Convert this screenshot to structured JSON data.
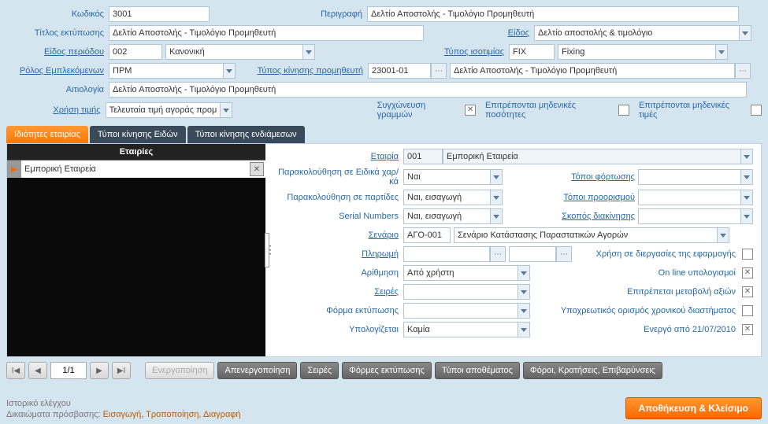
{
  "header": {
    "code_label": "Κωδικός",
    "code": "3001",
    "desc_label": "Περιγραφή",
    "desc": "Δελτίο Αποστολής - Τιμολόγιο Προμηθευτή",
    "print_title_label": "Τίτλος εκτύπωσης",
    "print_title": "Δελτίο Αποστολής - Τιμολόγιο Προμηθευτή",
    "type_label": "Είδος",
    "type": "Δελτίο αποστολής & τιμολόγιο",
    "period_type_label": "Είδος περιόδου",
    "period_code": "002",
    "period_name": "Κανονική",
    "rate_type_label": "Τύπος ισοτιμίας",
    "rate_code": "FIX",
    "rate_name": "Fixing",
    "role_label": "Ρόλος Εμπλεκόμενων",
    "role": "ΠΡΜ",
    "supplier_move_label": "Τύπος κίνησης προμηθευτή",
    "supplier_move_code": "23001-01",
    "supplier_move_name": "Δελτίο Αποστολής - Τιμολόγιο Προμηθευτή",
    "reason_label": "Αιτιολογία",
    "reason": "Δελτίο Αποστολής - Τιμολόγιο Προμηθευτή",
    "price_use_label": "Χρήση τιμής",
    "price_use": "Τελευταία τιμή αγοράς προμη…",
    "merge_lines_label": "Συγχώνευση γραμμών",
    "zero_qty_label": "Επιτρέπονται μηδενικές ποσότητες",
    "zero_val_label": "Επιτρέπονται μηδενικές τιμές"
  },
  "tabs": {
    "t1": "Ιδιότητες εταιρίας",
    "t2": "Τύποι κίνησης Ειδών",
    "t3": "Τύποι κίνησης ενδιάμεσων"
  },
  "companies": {
    "header": "Εταιρίες",
    "row1": "Εμπορική Εταιρεία"
  },
  "details": {
    "company_label": "Εταιρία",
    "company_code": "001",
    "company_name": "Εμπορική Εταιρεία",
    "special_chars_label": "Παρακολούθηση σε Ειδικά χαρ/κά",
    "special_chars": "Ναι",
    "load_places_label": "Τόποι φόρτωσης",
    "batches_label": "Παρακολούθηση σε παρτίδες",
    "batches": "Ναι, εισαγωγή",
    "dest_places_label": "Τόποι προορισμού",
    "serials_label": "Serial Numbers",
    "serials": "Ναι, εισαγωγή",
    "move_purpose_label": "Σκοπός διακίνησης",
    "scenario_label": "Σενάριο",
    "scenario_code": "ΑΓΟ-001",
    "scenario_name": "Σενάριο Κατάστασης Παραστατικών Αγορών",
    "payment_label": "Πληρωμή",
    "app_use_label": "Χρήση σε διεργασίες της εφαρμογής",
    "numbering_label": "Αρίθμηση",
    "numbering": "Από χρήστη",
    "online_calc_label": "On line υπολογισμοί",
    "series_label": "Σειρές",
    "value_change_label": "Επιτρέπεται μεταβολή αξιών",
    "print_form_label": "Φόρμα εκτύπωσης",
    "mandatory_time_label": "Υποχρεωτικός ορισμός χρονικού διαστήματος",
    "computed_label": "Υπολογίζεται",
    "computed": "Καμία",
    "active_from_label": "Ενεργό από 21/07/2010"
  },
  "pager": {
    "page": "1/1"
  },
  "buttons": {
    "activate": "Ενεργοποίηση",
    "deactivate": "Απενεργοποίηση",
    "series": "Σειρές",
    "print_forms": "Φόρμες εκτύπωσης",
    "stock_types": "Τύποι αποθέματος",
    "taxes": "Φόροι, Κρατήσεις, Επιβαρύνσεις"
  },
  "footer": {
    "audit": "Ιστορικό ελέγχου",
    "perms_label": "Δικαιώματα πρόσβασης:",
    "perms_value": "Εισαγωγή, Τροποποίηση, Διαγραφή",
    "save": "Αποθήκευση & Κλείσιμο"
  }
}
